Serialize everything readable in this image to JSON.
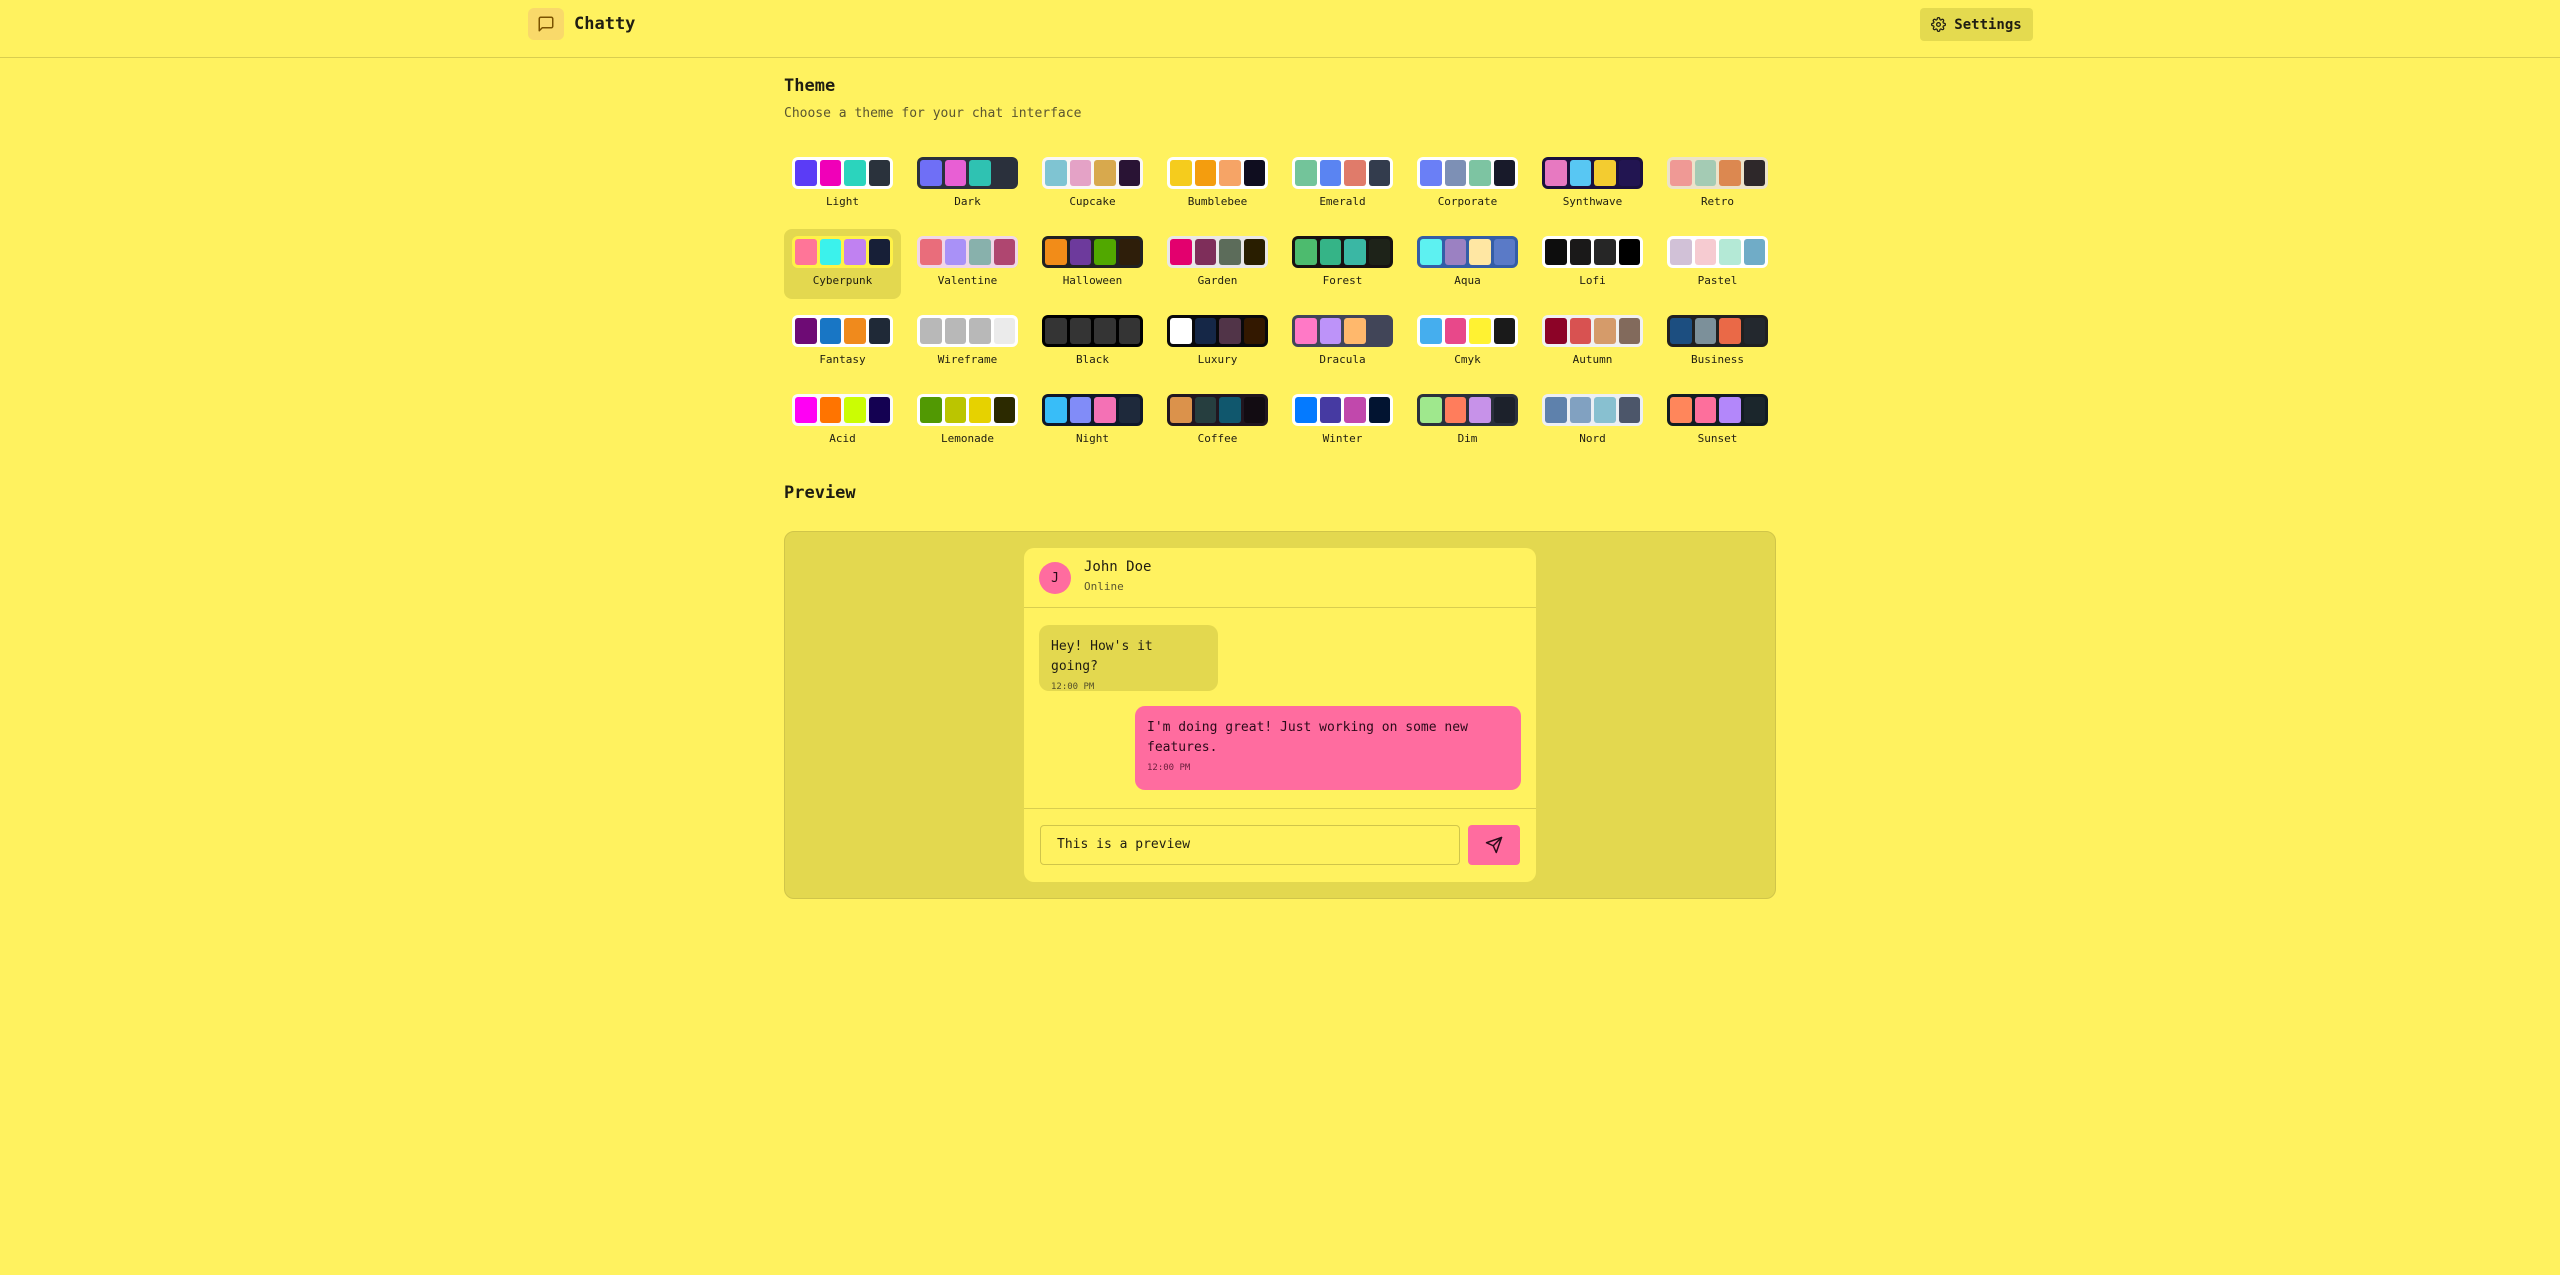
{
  "header": {
    "app_title": "Chatty",
    "settings_label": "Settings"
  },
  "theme_section": {
    "title": "Theme",
    "subtitle": "Choose a theme for your chat interface",
    "selected": "Cyberpunk",
    "themes": [
      {
        "name": "Light",
        "bg": "#ffffff",
        "colors": [
          "#5b3cf6",
          "#f000b8",
          "#2bd4bd",
          "#2a323c"
        ]
      },
      {
        "name": "Dark",
        "bg": "#2a303c",
        "colors": [
          "#6f6ff6",
          "#e85fd4",
          "#2fc2b2",
          "#2a303c"
        ]
      },
      {
        "name": "Cupcake",
        "bg": "#faf7f5",
        "colors": [
          "#7fc4d2",
          "#e4a2c6",
          "#d8a94d",
          "#291334"
        ]
      },
      {
        "name": "Bumblebee",
        "bg": "#ffffff",
        "colors": [
          "#f5cc1d",
          "#f49d0e",
          "#f6a466",
          "#0f0d1f"
        ]
      },
      {
        "name": "Emerald",
        "bg": "#ffffff",
        "colors": [
          "#73c49a",
          "#5a84f2",
          "#e07b6a",
          "#333c4d"
        ]
      },
      {
        "name": "Corporate",
        "bg": "#ffffff",
        "colors": [
          "#6a7ff6",
          "#7d90b5",
          "#7dc4a2",
          "#181a2a"
        ]
      },
      {
        "name": "Synthwave",
        "bg": "#1a103d",
        "colors": [
          "#e779c1",
          "#58c7f3",
          "#f3cc30",
          "#221551"
        ]
      },
      {
        "name": "Retro",
        "bg": "#ece3ca",
        "colors": [
          "#ef9995",
          "#a4cbb4",
          "#dc8850",
          "#2e282a"
        ]
      },
      {
        "name": "Cyberpunk",
        "bg": "#fff248",
        "colors": [
          "#ff7598",
          "#3bf2ec",
          "#c081f1",
          "#171f37"
        ]
      },
      {
        "name": "Valentine",
        "bg": "#f0d6e8",
        "colors": [
          "#e96d7b",
          "#a991f7",
          "#88b1ac",
          "#af4670"
        ]
      },
      {
        "name": "Halloween",
        "bg": "#212121",
        "colors": [
          "#f28c18",
          "#6d3a9c",
          "#51a800",
          "#2e1e0a"
        ]
      },
      {
        "name": "Garden",
        "bg": "#e9e7e7",
        "colors": [
          "#e3006e",
          "#7e2e5a",
          "#5c6c5a",
          "#291e00"
        ]
      },
      {
        "name": "Forest",
        "bg": "#171212",
        "colors": [
          "#4dbb6e",
          "#35b487",
          "#3ab7a4",
          "#1e2319"
        ]
      },
      {
        "name": "Aqua",
        "bg": "#345da7",
        "colors": [
          "#5df1f1",
          "#9b81c2",
          "#ffe7a3",
          "#5a7ac7"
        ]
      },
      {
        "name": "Lofi",
        "bg": "#ffffff",
        "colors": [
          "#0d0d0d",
          "#1a1919",
          "#262626",
          "#000000"
        ]
      },
      {
        "name": "Pastel",
        "bg": "#ffffff",
        "colors": [
          "#d1c1d7",
          "#f6cbd1",
          "#b4e9d6",
          "#70acc7"
        ]
      },
      {
        "name": "Fantasy",
        "bg": "#ffffff",
        "colors": [
          "#6e0b75",
          "#1876c5",
          "#f08a1c",
          "#1f2937"
        ]
      },
      {
        "name": "Wireframe",
        "bg": "#ffffff",
        "colors": [
          "#b8b8b8",
          "#b8b8b8",
          "#b8b8b8",
          "#ebebeb"
        ]
      },
      {
        "name": "Black",
        "bg": "#000000",
        "colors": [
          "#343434",
          "#343434",
          "#343434",
          "#343434"
        ]
      },
      {
        "name": "Luxury",
        "bg": "#09090b",
        "colors": [
          "#ffffff",
          "#152747",
          "#513448",
          "#331800"
        ]
      },
      {
        "name": "Dracula",
        "bg": "#414558",
        "colors": [
          "#ff79c6",
          "#bd93f9",
          "#ffb86c",
          "#414558"
        ]
      },
      {
        "name": "Cmyk",
        "bg": "#ffffff",
        "colors": [
          "#45aeee",
          "#e8488a",
          "#fff232",
          "#1a1a1a"
        ]
      },
      {
        "name": "Autumn",
        "bg": "#f1f1f1",
        "colors": [
          "#8c0327",
          "#d85251",
          "#d59b6a",
          "#826a5c"
        ]
      },
      {
        "name": "Business",
        "bg": "#202020",
        "colors": [
          "#1c4e80",
          "#7c909a",
          "#ea6947",
          "#23282e"
        ]
      },
      {
        "name": "Acid",
        "bg": "#fafafa",
        "colors": [
          "#ff00f4",
          "#ff7400",
          "#cbfd03",
          "#140152"
        ]
      },
      {
        "name": "Lemonade",
        "bg": "#ffffff",
        "colors": [
          "#519903",
          "#bbc500",
          "#e6d200",
          "#2c2a00"
        ]
      },
      {
        "name": "Night",
        "bg": "#0f1729",
        "colors": [
          "#38bdf8",
          "#818cf8",
          "#f471b5",
          "#1e293b"
        ]
      },
      {
        "name": "Coffee",
        "bg": "#20161f",
        "colors": [
          "#db924b",
          "#263e3f",
          "#10576d",
          "#120c12"
        ]
      },
      {
        "name": "Winter",
        "bg": "#ffffff",
        "colors": [
          "#047aff",
          "#463aa2",
          "#c148ac",
          "#021431"
        ]
      },
      {
        "name": "Dim",
        "bg": "#2a303c",
        "colors": [
          "#9fe88d",
          "#ff7d5c",
          "#c792e9",
          "#1c212b"
        ]
      },
      {
        "name": "Nord",
        "bg": "#eceff4",
        "colors": [
          "#5e81ac",
          "#81a1c1",
          "#88c0d0",
          "#4c566a"
        ]
      },
      {
        "name": "Sunset",
        "bg": "#121c22",
        "colors": [
          "#ff865b",
          "#fd6f9c",
          "#b387fa",
          "#1b262c"
        ]
      }
    ]
  },
  "preview": {
    "title": "Preview",
    "contact": {
      "initial": "J",
      "name": "John Doe",
      "status": "Online"
    },
    "messages": [
      {
        "text": "Hey! How's it going?",
        "time": "12:00 PM",
        "sent": false
      },
      {
        "text": "I'm doing great! Just working on some new features.",
        "time": "12:00 PM",
        "sent": true
      }
    ],
    "input_value": "This is a preview"
  }
}
